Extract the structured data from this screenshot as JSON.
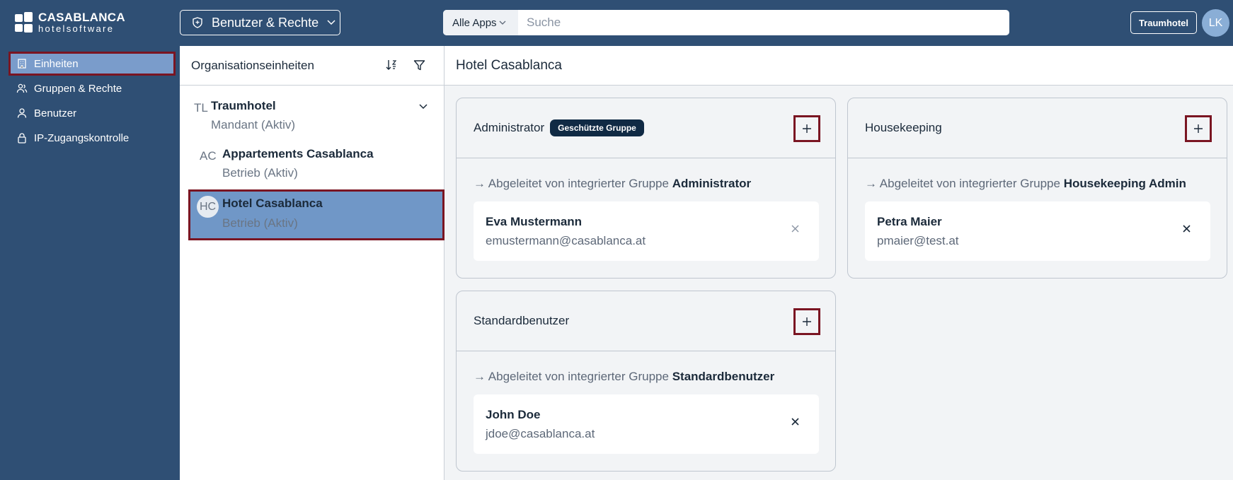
{
  "header": {
    "logo_line1": "CASABLANCA",
    "logo_line2": "hotelsoftware",
    "app_switch_label": "Benutzer & Rechte",
    "search_scope": "Alle Apps",
    "search_placeholder": "Suche",
    "tenant_button": "Traumhotel",
    "user_initials": "LK"
  },
  "sidebar": {
    "items": [
      {
        "label": "Einheiten",
        "icon": "building-icon",
        "active": true
      },
      {
        "label": "Gruppen & Rechte",
        "icon": "users-icon",
        "active": false
      },
      {
        "label": "Benutzer",
        "icon": "user-icon",
        "active": false
      },
      {
        "label": "IP-Zugangskontrolle",
        "icon": "lock-icon",
        "active": false
      }
    ]
  },
  "org": {
    "title": "Organisationseinheiten",
    "items": [
      {
        "abbr": "TL",
        "name": "Traumhotel",
        "sub": "Mandant (Aktiv)"
      },
      {
        "abbr": "AC",
        "name": "Appartements Casablanca",
        "sub": "Betrieb (Aktiv)"
      },
      {
        "abbr": "HC",
        "name": "Hotel Casablanca",
        "sub": "Betrieb (Aktiv)"
      }
    ]
  },
  "main": {
    "title": "Hotel Casablanca",
    "derived_prefix": "Abgeleitet von integrierter Gruppe",
    "groups": [
      {
        "name": "Administrator",
        "badge": "Geschützte Gruppe",
        "derived_group": "Administrator",
        "member_name": "Eva Mustermann",
        "member_email": "emustermann@casablanca.at"
      },
      {
        "name": "Housekeeping",
        "badge": "",
        "derived_group": "Housekeeping Admin",
        "member_name": "Petra Maier",
        "member_email": "pmaier@test.at"
      },
      {
        "name": "Standardbenutzer",
        "badge": "",
        "derived_group": "Standardbenutzer",
        "member_name": "John Doe",
        "member_email": "jdoe@casablanca.at"
      }
    ]
  },
  "colors": {
    "topbar": "#2f4f74",
    "active_nav": "#7a9ccb",
    "selected_org": "#7097c7",
    "highlight_border": "#7a1522",
    "badge": "#102a44"
  }
}
